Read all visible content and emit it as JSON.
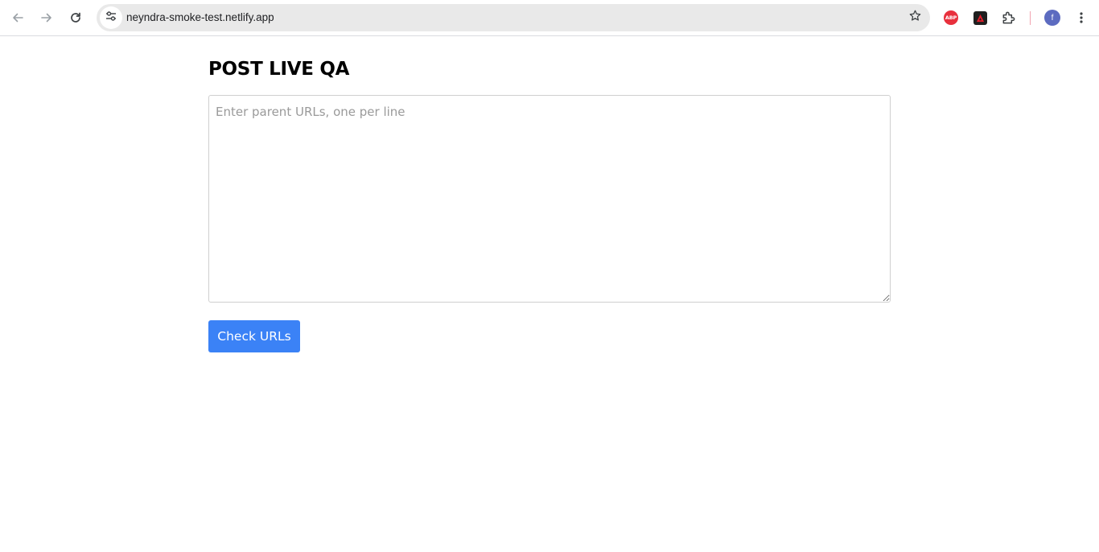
{
  "browser": {
    "address_bar": {
      "url": "neyndra-smoke-test.netlify.app"
    },
    "icons": {
      "back": "arrow-left-icon",
      "forward": "arrow-right-icon",
      "reload": "reload-icon",
      "site_info": "tune-icon",
      "bookmark": "star-icon",
      "extension_1": "adblock-plus-icon",
      "extension_2": "red-triangle-extension-icon",
      "extensions_menu": "puzzle-icon",
      "more": "more-vert-icon"
    },
    "extension_abp_text": "ABP",
    "profile_initial": "f"
  },
  "page": {
    "title": "POST LIVE QA",
    "textarea": {
      "value": "",
      "placeholder": "Enter parent URLs, one per line"
    },
    "check_button_label": "Check URLs"
  },
  "colors": {
    "button_bg": "#3b82f6",
    "button_text": "#ffffff",
    "abp_red": "#e8303d",
    "profile_bg": "#5c6bc0"
  }
}
